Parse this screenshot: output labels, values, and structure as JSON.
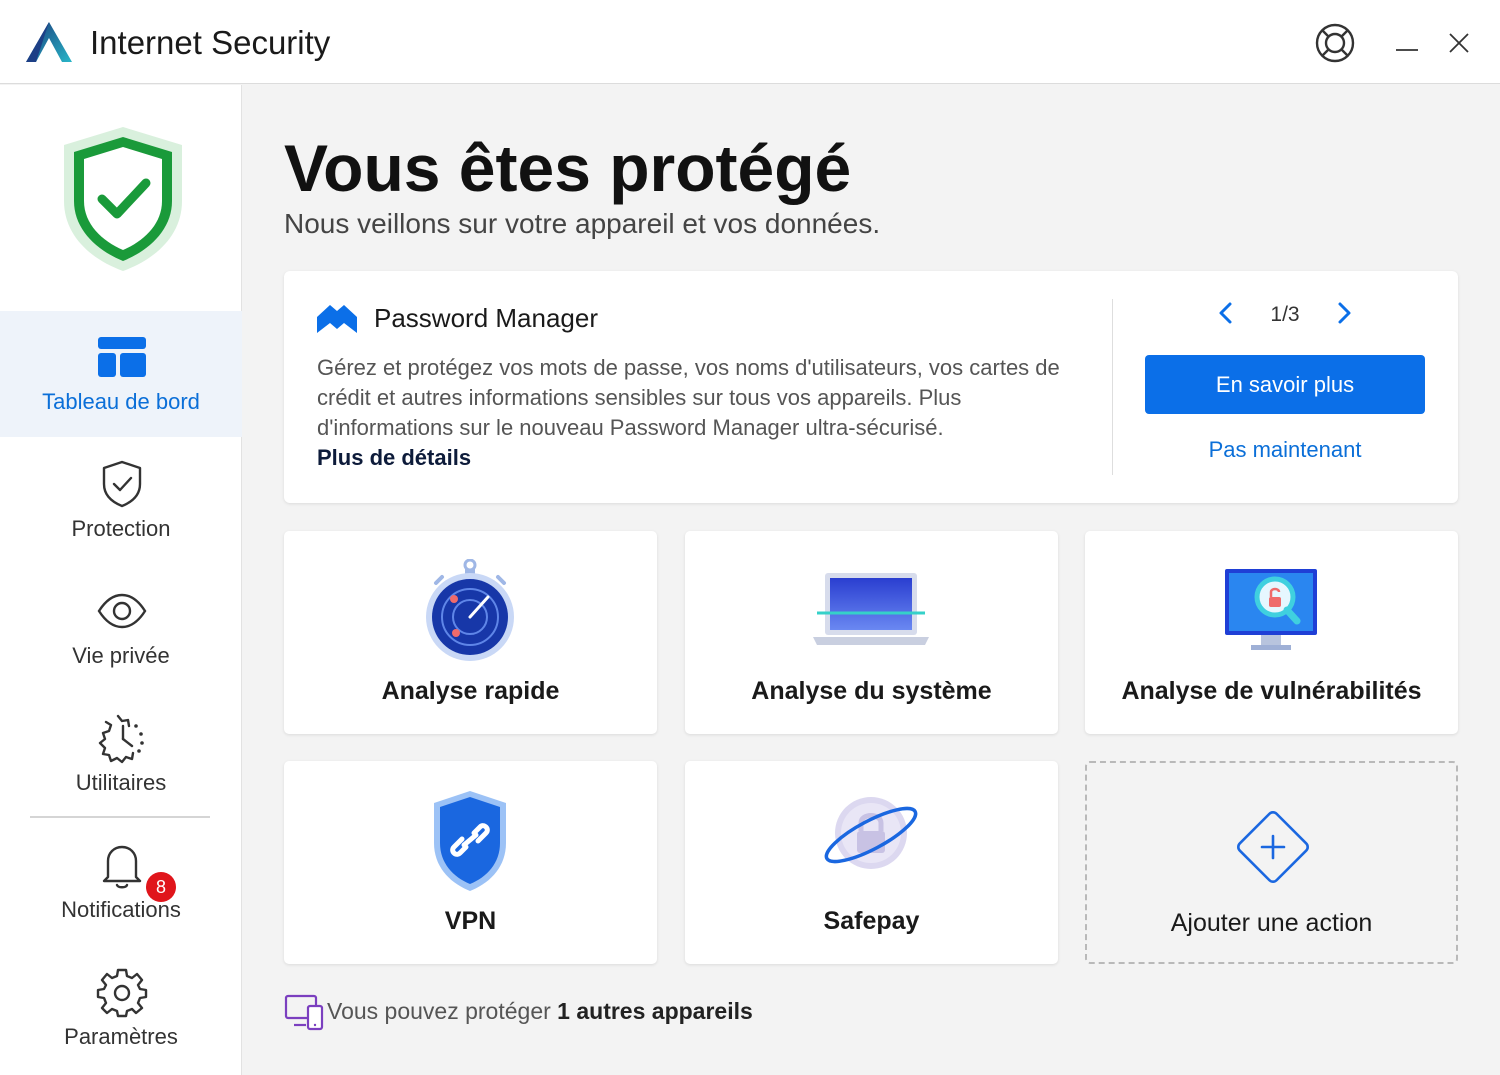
{
  "window": {
    "title": "Internet Security",
    "controls": [
      "help-icon",
      "minimize-icon",
      "close-icon"
    ]
  },
  "sidebar": {
    "status_icon": "shield-check-icon",
    "items": [
      {
        "label": "Tableau de bord",
        "icon": "dashboard-icon",
        "active": true
      },
      {
        "label": "Protection",
        "icon": "shield-icon"
      },
      {
        "label": "Vie privée",
        "icon": "eye-icon"
      },
      {
        "label": "Utilitaires",
        "icon": "utilities-icon"
      },
      {
        "label": "Notifications",
        "icon": "bell-icon",
        "badge": "8"
      },
      {
        "label": "Paramètres",
        "icon": "gear-icon"
      }
    ]
  },
  "header": {
    "title": "Vous êtes protégé",
    "subtitle": "Nous veillons sur votre appareil et vos données."
  },
  "promo": {
    "icon": "password-manager-icon",
    "title": "Password Manager",
    "description": "Gérez et protégez vos mots de passe, vos noms d'utilisateurs, vos cartes de crédit et autres informations sensibles sur tous vos appareils. Plus d'informations sur le nouveau Password Manager ultra-sécurisé.",
    "details_link": "Plus de détails",
    "pager": "1/3",
    "primary_button": "En savoir plus",
    "secondary_button": "Pas maintenant"
  },
  "actions": [
    {
      "label": "Analyse rapide",
      "icon": "quick-scan-icon"
    },
    {
      "label": "Analyse du système",
      "icon": "system-scan-icon"
    },
    {
      "label": "Analyse de vulnérabilités",
      "icon": "vulnerability-scan-icon"
    },
    {
      "label": "VPN",
      "icon": "vpn-icon"
    },
    {
      "label": "Safepay",
      "icon": "safepay-icon"
    },
    {
      "label": "Ajouter une action",
      "icon": "add-action-icon"
    }
  ],
  "footer": {
    "text_before": "Vous pouvez protéger ",
    "text_bold": "1 autres appareils"
  },
  "colors": {
    "accent": "#0b6fe8",
    "success": "#1a9a3a",
    "badge": "#e0151b"
  }
}
